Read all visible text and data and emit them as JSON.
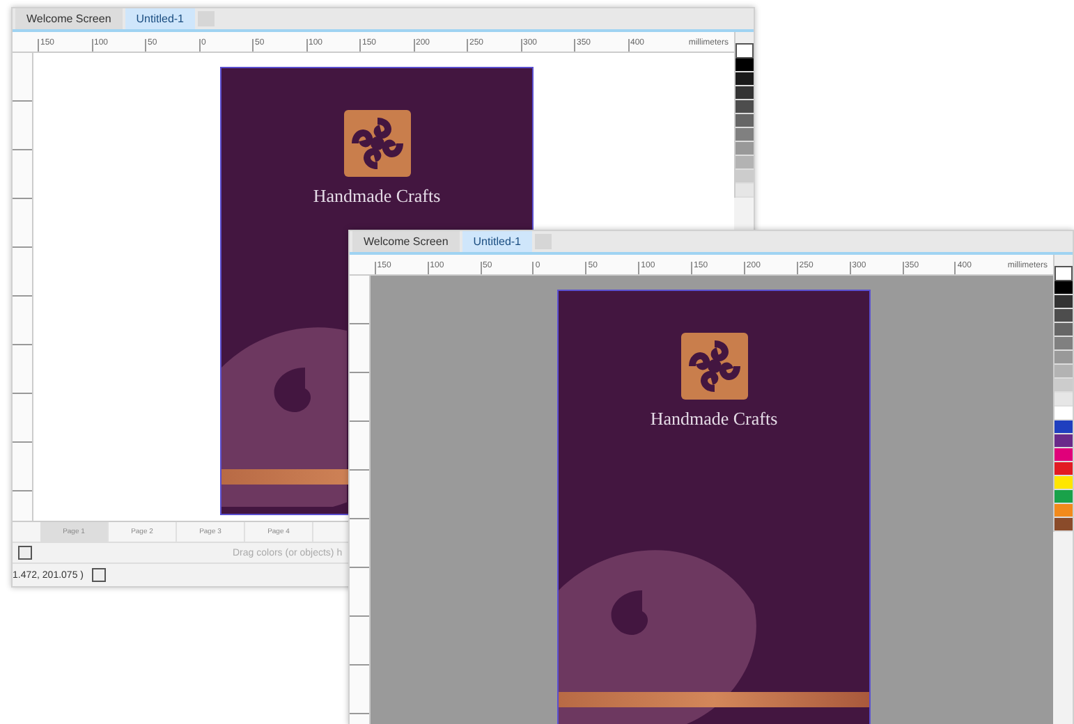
{
  "windows": [
    {
      "tabs": [
        {
          "label": "Welcome Screen",
          "selected": false
        },
        {
          "label": "Untitled-1",
          "selected": true
        }
      ],
      "ruler": {
        "labels": [
          "150",
          "100",
          "50",
          "0",
          "50",
          "100",
          "150",
          "200",
          "250",
          "300",
          "350",
          "400"
        ],
        "unit": "millimeters"
      },
      "canvas": {
        "kind": "white"
      },
      "page": {
        "title": "Handmade Crafts"
      },
      "palette": [
        {
          "color": "#000000"
        },
        {
          "color": "#1a1a1a"
        },
        {
          "color": "#333333"
        },
        {
          "color": "#4d4d4d"
        },
        {
          "color": "#666666"
        },
        {
          "color": "#808080"
        },
        {
          "color": "#999999"
        },
        {
          "color": "#b3b3b3"
        },
        {
          "color": "#cccccc"
        },
        {
          "color": "#e6e6e6"
        }
      ],
      "page_tabs": [
        {
          "label": "Page 1",
          "selected": true
        },
        {
          "label": "Page 2",
          "selected": false
        },
        {
          "label": "Page 3",
          "selected": false
        },
        {
          "label": "Page 4",
          "selected": false
        }
      ],
      "color_hint": "Drag colors (or objects) h",
      "status": "1.472, 201.075 )"
    },
    {
      "tabs": [
        {
          "label": "Welcome Screen",
          "selected": false
        },
        {
          "label": "Untitled-1",
          "selected": true
        }
      ],
      "ruler": {
        "labels": [
          "150",
          "100",
          "50",
          "0",
          "50",
          "100",
          "150",
          "200",
          "250",
          "300",
          "350",
          "400"
        ],
        "unit": "millimeters"
      },
      "canvas": {
        "kind": "gray"
      },
      "page": {
        "title": "Handmade Crafts"
      },
      "palette": [
        {
          "color": "#000000"
        },
        {
          "color": "#333333"
        },
        {
          "color": "#4d4d4d"
        },
        {
          "color": "#666666"
        },
        {
          "color": "#808080"
        },
        {
          "color": "#999999"
        },
        {
          "color": "#b3b3b3"
        },
        {
          "color": "#cccccc"
        },
        {
          "color": "#e6e6e6"
        },
        {
          "color": "#ffffff"
        },
        {
          "color": "#1f3fbf"
        },
        {
          "color": "#6a2a8a"
        },
        {
          "color": "#e0007a"
        },
        {
          "color": "#e21b23"
        },
        {
          "color": "#ffe600"
        },
        {
          "color": "#19a24a"
        },
        {
          "color": "#f28a1c"
        },
        {
          "color": "#8a4b2a"
        }
      ]
    }
  ]
}
